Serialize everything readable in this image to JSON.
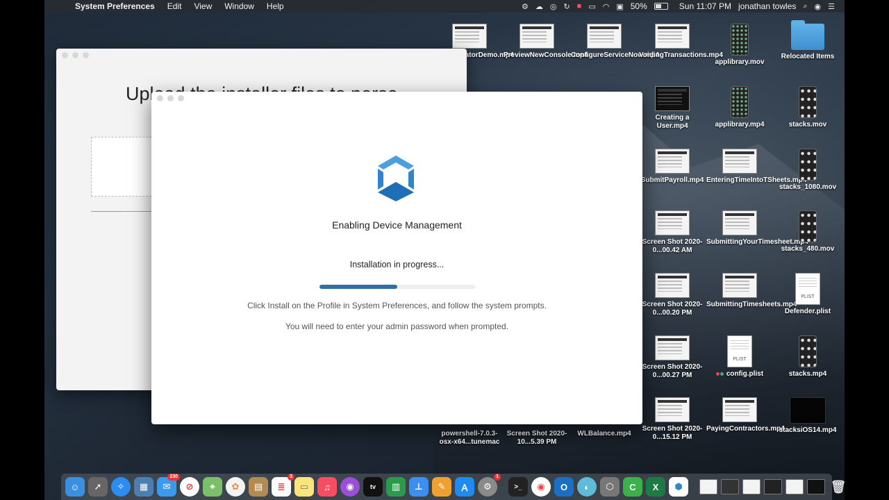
{
  "menubar": {
    "apple": "",
    "app_name": "System Preferences",
    "menus": [
      "Edit",
      "View",
      "Window",
      "Help"
    ],
    "battery": "50%",
    "clock": "Sun 11:07 PM",
    "user": "jonathan towles"
  },
  "desktop": {
    "icons": [
      {
        "label": "OrchestratorDemo.mp4",
        "kind": "thumb"
      },
      {
        "label": "PreviewNewConsole.mp4",
        "kind": "thumb"
      },
      {
        "label": "ConfigureServiceNow.mp4",
        "kind": "thumb"
      },
      {
        "label": "VoidingTransactions.mp4",
        "kind": "thumb"
      },
      {
        "label": "applibrary.mov",
        "kind": "phone"
      },
      {
        "label": "Relocated Items",
        "kind": "folder"
      },
      {
        "label": "Creating a User.mp4",
        "kind": "thumb-dark"
      },
      {
        "label": "applibrary.mp4",
        "kind": "phone"
      },
      {
        "label": "stacks.mov",
        "kind": "phone-sm"
      },
      {
        "label": "SubmitPayroll.mp4",
        "kind": "thumb"
      },
      {
        "label": "EnteringTimeIntoTSheets.mp4",
        "kind": "thumb"
      },
      {
        "label": "stacks_1080.mov",
        "kind": "phone-sm"
      },
      {
        "label": "Screen Shot 2020-0...00.42 AM",
        "kind": "thumb"
      },
      {
        "label": "SubmittingYourTimesheet.mp4",
        "kind": "thumb"
      },
      {
        "label": "stacks_480.mov",
        "kind": "phone-sm"
      },
      {
        "label": "Screen Shot 2020-0...00.20 PM",
        "kind": "thumb"
      },
      {
        "label": "SubmittingTimesheets.mp4",
        "kind": "thumb"
      },
      {
        "label": "Defender.plist",
        "kind": "doc"
      },
      {
        "label": "Screen Shot 2020-0...00.27 PM",
        "kind": "thumb"
      },
      {
        "label": "config.plist",
        "kind": "doc"
      },
      {
        "label": "stacks.mp4",
        "kind": "phone-sm"
      },
      {
        "label": "powershell-7.0.3-osx-x64...tunemac",
        "kind": "none"
      },
      {
        "label": "Screen Shot 2020-10...5.39 PM",
        "kind": "none"
      },
      {
        "label": "WLBalance.mp4",
        "kind": "none"
      },
      {
        "label": "Screen Shot 2020-0...15.12 PM",
        "kind": "thumb"
      },
      {
        "label": "PayingContractors.mp4",
        "kind": "thumb"
      },
      {
        "label": "stacksiOS14.mp4",
        "kind": "black"
      }
    ],
    "plist_text": "PLIST"
  },
  "back_window": {
    "heading": "Upload the installer files to perse"
  },
  "dialog": {
    "title": "Enabling Device Management",
    "status": "Installation in progress...",
    "progress": 0.5,
    "hint1": "Click Install on the Profile in System Preferences, and follow the system prompts.",
    "hint2": "You will need to enter your admin password when prompted."
  },
  "dock": {
    "mail_badge": "230",
    "reminders_badge": "3",
    "prefs_badge": "1",
    "tv_label": "tv"
  },
  "colors": {
    "accent": "#2e6fa8",
    "logo_light": "#4a9fe0",
    "logo_dark": "#1f6fb8"
  }
}
